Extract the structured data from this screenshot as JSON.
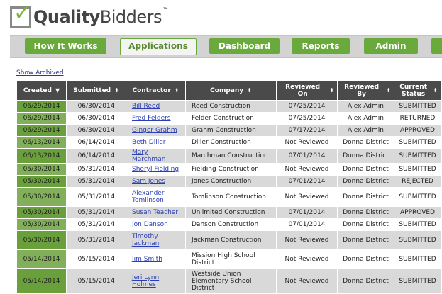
{
  "brand": {
    "name_bold": "Quality",
    "name_rest": "Bidders",
    "tm": "™"
  },
  "nav": [
    {
      "label": "How It Works"
    },
    {
      "label": "Applications"
    },
    {
      "label": "Dashboard"
    },
    {
      "label": "Reports"
    },
    {
      "label": "Admin"
    }
  ],
  "show_archived": "Show Archived",
  "table": {
    "headers": [
      "Created",
      "Submitted",
      "Contractor",
      "Company",
      "Reviewed On",
      "Reviewed By",
      "Current Status"
    ],
    "rows": [
      {
        "created": "06/29/2014",
        "submitted": "06/30/2014",
        "contractor": "Bill Reed",
        "company": "Reed Construction",
        "reviewed_on": "07/25/2014",
        "reviewed_by": "Alex Admin",
        "status": "SUBMITTED"
      },
      {
        "created": "06/29/2014",
        "submitted": "06/30/2014",
        "contractor": "Fred Felders",
        "company": "Felder Construction",
        "reviewed_on": "07/25/2014",
        "reviewed_by": "Alex Admin",
        "status": "RETURNED"
      },
      {
        "created": "06/29/2014",
        "submitted": "06/30/2014",
        "contractor": "Ginger Grahm",
        "company": "Grahm Construction",
        "reviewed_on": "07/17/2014",
        "reviewed_by": "Alex Admin",
        "status": "APPROVED"
      },
      {
        "created": "06/13/2014",
        "submitted": "06/14/2014",
        "contractor": "Beth Diller",
        "company": "Diller Construction",
        "reviewed_on": "Not Reviewed",
        "reviewed_by": "Donna District",
        "status": "SUBMITTED"
      },
      {
        "created": "06/13/2014",
        "submitted": "06/14/2014",
        "contractor": "Mary Marchman",
        "company": "Marchman Construction",
        "reviewed_on": "07/01/2014",
        "reviewed_by": "Donna District",
        "status": "SUBMITTED"
      },
      {
        "created": "05/30/2014",
        "submitted": "05/31/2014",
        "contractor": "Sheryl Fielding",
        "company": "Fielding Construction",
        "reviewed_on": "Not Reviewed",
        "reviewed_by": "Donna District",
        "status": "SUBMITTED"
      },
      {
        "created": "05/30/2014",
        "submitted": "05/31/2014",
        "contractor": "Sam Jones",
        "company": "Jones Construction",
        "reviewed_on": "07/01/2014",
        "reviewed_by": "Donna District",
        "status": "REJECTED"
      },
      {
        "created": "05/30/2014",
        "submitted": "05/31/2014",
        "contractor": "Alexander Tomlinson",
        "company": "Tomlinson Construction",
        "reviewed_on": "Not Reviewed",
        "reviewed_by": "Donna District",
        "status": "SUBMITTED"
      },
      {
        "created": "05/30/2014",
        "submitted": "05/31/2014",
        "contractor": "Susan Teacher",
        "company": "Unlimited Construction",
        "reviewed_on": "07/01/2014",
        "reviewed_by": "Donna District",
        "status": "APPROVED"
      },
      {
        "created": "05/30/2014",
        "submitted": "05/31/2014",
        "contractor": "Jon Danson",
        "company": "Danson Construction",
        "reviewed_on": "07/01/2014",
        "reviewed_by": "Donna District",
        "status": "SUBMITTED"
      },
      {
        "created": "05/30/2014",
        "submitted": "05/31/2014",
        "contractor": "Timothy Jackman",
        "company": "Jackman Construction",
        "reviewed_on": "Not Reviewed",
        "reviewed_by": "Donna District",
        "status": "SUBMITTED"
      },
      {
        "created": "05/14/2014",
        "submitted": "05/15/2014",
        "contractor": "Jim Smith",
        "company": "Mission High School District",
        "reviewed_on": "Not Reviewed",
        "reviewed_by": "Donna District",
        "status": "SUBMITTED"
      },
      {
        "created": "05/14/2014",
        "submitted": "05/15/2014",
        "contractor": "Jeri Lynn Holmes",
        "company": "Westside Union Elementary School District",
        "reviewed_on": "Not Reviewed",
        "reviewed_by": "Donna District",
        "status": "SUBMITTED"
      }
    ]
  }
}
